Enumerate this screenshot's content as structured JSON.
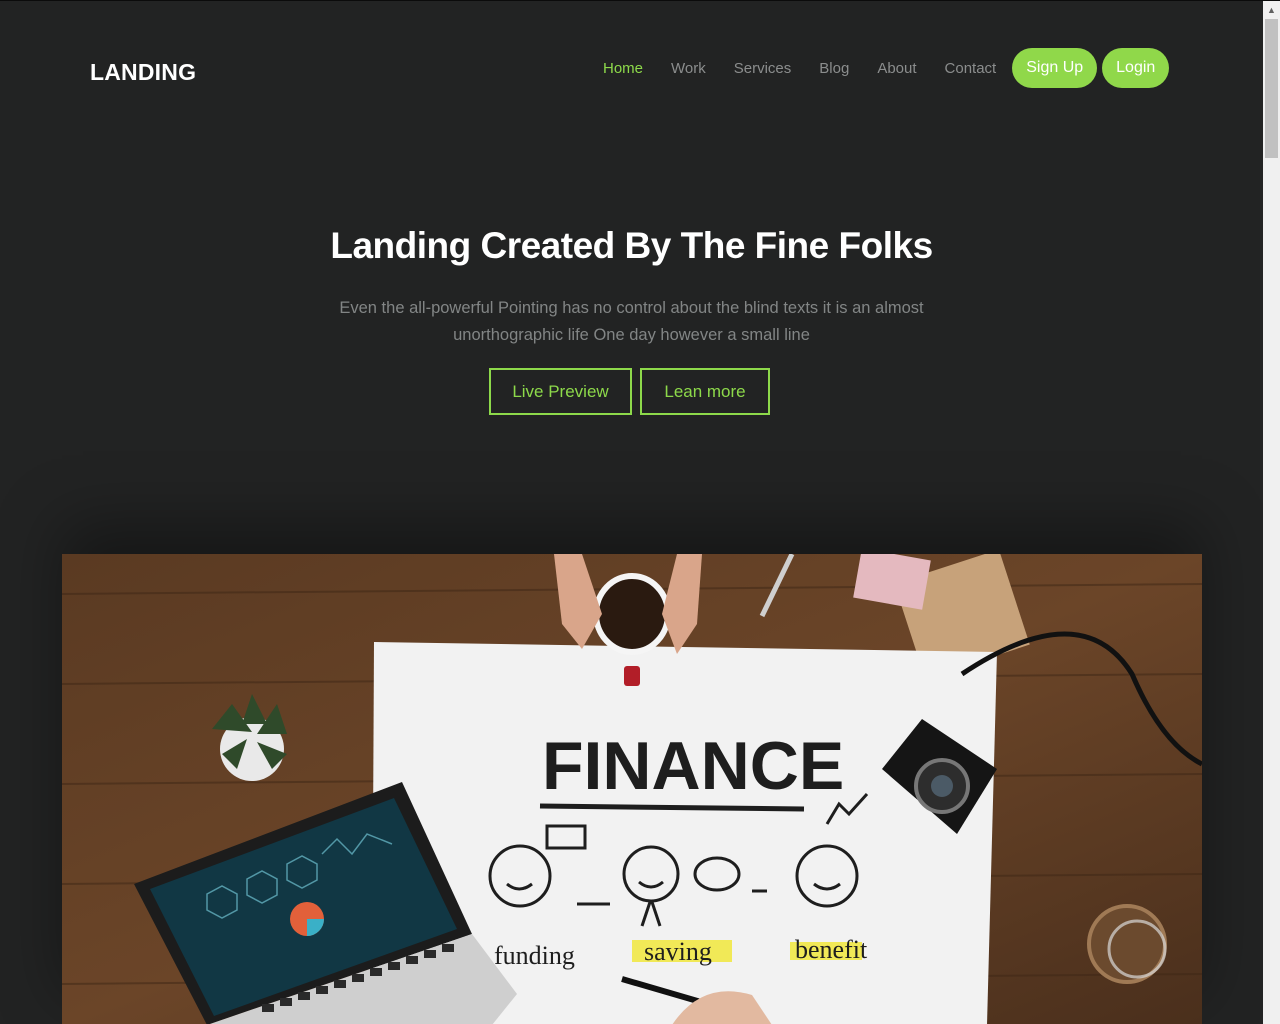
{
  "header": {
    "logo": "LANDING",
    "nav": [
      {
        "label": "Home",
        "active": true
      },
      {
        "label": "Work",
        "active": false
      },
      {
        "label": "Services",
        "active": false
      },
      {
        "label": "Blog",
        "active": false
      },
      {
        "label": "About",
        "active": false
      },
      {
        "label": "Contact",
        "active": false
      }
    ],
    "signup_label": "Sign Up",
    "login_label": "Login"
  },
  "hero": {
    "title": "Landing Created By The Fine Folks",
    "subtitle": "Even the all-powerful Pointing has no control about the blind texts it is an almost unorthographic life One day however a small line",
    "live_preview_label": "Live Preview",
    "learn_more_label": "Lean more"
  },
  "image": {
    "heading": "FINANCE",
    "words": [
      "funding",
      "saving",
      "benefit"
    ]
  },
  "colors": {
    "background": "#222323",
    "accent": "#8dd94a",
    "nav_text": "#8b8d8d"
  },
  "icons": [
    "chevron-up-icon"
  ]
}
